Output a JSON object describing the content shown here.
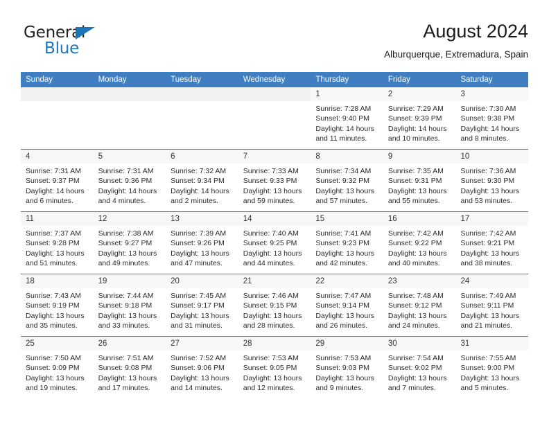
{
  "brand": {
    "name_part1": "General",
    "name_part2": "Blue",
    "triangle_color": "#1b75bb"
  },
  "header": {
    "title": "August 2024",
    "subtitle": "Alburquerque, Extremadura, Spain"
  },
  "calendar": {
    "header_color": "#3f7fc1",
    "weekdays": [
      "Sunday",
      "Monday",
      "Tuesday",
      "Wednesday",
      "Thursday",
      "Friday",
      "Saturday"
    ],
    "weeks": [
      [
        {
          "day": "",
          "sunrise": "",
          "sunset": "",
          "daylight_line1": "",
          "daylight_line2": ""
        },
        {
          "day": "",
          "sunrise": "",
          "sunset": "",
          "daylight_line1": "",
          "daylight_line2": ""
        },
        {
          "day": "",
          "sunrise": "",
          "sunset": "",
          "daylight_line1": "",
          "daylight_line2": ""
        },
        {
          "day": "",
          "sunrise": "",
          "sunset": "",
          "daylight_line1": "",
          "daylight_line2": ""
        },
        {
          "day": "1",
          "sunrise": "Sunrise: 7:28 AM",
          "sunset": "Sunset: 9:40 PM",
          "daylight_line1": "Daylight: 14 hours",
          "daylight_line2": "and 11 minutes."
        },
        {
          "day": "2",
          "sunrise": "Sunrise: 7:29 AM",
          "sunset": "Sunset: 9:39 PM",
          "daylight_line1": "Daylight: 14 hours",
          "daylight_line2": "and 10 minutes."
        },
        {
          "day": "3",
          "sunrise": "Sunrise: 7:30 AM",
          "sunset": "Sunset: 9:38 PM",
          "daylight_line1": "Daylight: 14 hours",
          "daylight_line2": "and 8 minutes."
        }
      ],
      [
        {
          "day": "4",
          "sunrise": "Sunrise: 7:31 AM",
          "sunset": "Sunset: 9:37 PM",
          "daylight_line1": "Daylight: 14 hours",
          "daylight_line2": "and 6 minutes."
        },
        {
          "day": "5",
          "sunrise": "Sunrise: 7:31 AM",
          "sunset": "Sunset: 9:36 PM",
          "daylight_line1": "Daylight: 14 hours",
          "daylight_line2": "and 4 minutes."
        },
        {
          "day": "6",
          "sunrise": "Sunrise: 7:32 AM",
          "sunset": "Sunset: 9:34 PM",
          "daylight_line1": "Daylight: 14 hours",
          "daylight_line2": "and 2 minutes."
        },
        {
          "day": "7",
          "sunrise": "Sunrise: 7:33 AM",
          "sunset": "Sunset: 9:33 PM",
          "daylight_line1": "Daylight: 13 hours",
          "daylight_line2": "and 59 minutes."
        },
        {
          "day": "8",
          "sunrise": "Sunrise: 7:34 AM",
          "sunset": "Sunset: 9:32 PM",
          "daylight_line1": "Daylight: 13 hours",
          "daylight_line2": "and 57 minutes."
        },
        {
          "day": "9",
          "sunrise": "Sunrise: 7:35 AM",
          "sunset": "Sunset: 9:31 PM",
          "daylight_line1": "Daylight: 13 hours",
          "daylight_line2": "and 55 minutes."
        },
        {
          "day": "10",
          "sunrise": "Sunrise: 7:36 AM",
          "sunset": "Sunset: 9:30 PM",
          "daylight_line1": "Daylight: 13 hours",
          "daylight_line2": "and 53 minutes."
        }
      ],
      [
        {
          "day": "11",
          "sunrise": "Sunrise: 7:37 AM",
          "sunset": "Sunset: 9:28 PM",
          "daylight_line1": "Daylight: 13 hours",
          "daylight_line2": "and 51 minutes."
        },
        {
          "day": "12",
          "sunrise": "Sunrise: 7:38 AM",
          "sunset": "Sunset: 9:27 PM",
          "daylight_line1": "Daylight: 13 hours",
          "daylight_line2": "and 49 minutes."
        },
        {
          "day": "13",
          "sunrise": "Sunrise: 7:39 AM",
          "sunset": "Sunset: 9:26 PM",
          "daylight_line1": "Daylight: 13 hours",
          "daylight_line2": "and 47 minutes."
        },
        {
          "day": "14",
          "sunrise": "Sunrise: 7:40 AM",
          "sunset": "Sunset: 9:25 PM",
          "daylight_line1": "Daylight: 13 hours",
          "daylight_line2": "and 44 minutes."
        },
        {
          "day": "15",
          "sunrise": "Sunrise: 7:41 AM",
          "sunset": "Sunset: 9:23 PM",
          "daylight_line1": "Daylight: 13 hours",
          "daylight_line2": "and 42 minutes."
        },
        {
          "day": "16",
          "sunrise": "Sunrise: 7:42 AM",
          "sunset": "Sunset: 9:22 PM",
          "daylight_line1": "Daylight: 13 hours",
          "daylight_line2": "and 40 minutes."
        },
        {
          "day": "17",
          "sunrise": "Sunrise: 7:42 AM",
          "sunset": "Sunset: 9:21 PM",
          "daylight_line1": "Daylight: 13 hours",
          "daylight_line2": "and 38 minutes."
        }
      ],
      [
        {
          "day": "18",
          "sunrise": "Sunrise: 7:43 AM",
          "sunset": "Sunset: 9:19 PM",
          "daylight_line1": "Daylight: 13 hours",
          "daylight_line2": "and 35 minutes."
        },
        {
          "day": "19",
          "sunrise": "Sunrise: 7:44 AM",
          "sunset": "Sunset: 9:18 PM",
          "daylight_line1": "Daylight: 13 hours",
          "daylight_line2": "and 33 minutes."
        },
        {
          "day": "20",
          "sunrise": "Sunrise: 7:45 AM",
          "sunset": "Sunset: 9:17 PM",
          "daylight_line1": "Daylight: 13 hours",
          "daylight_line2": "and 31 minutes."
        },
        {
          "day": "21",
          "sunrise": "Sunrise: 7:46 AM",
          "sunset": "Sunset: 9:15 PM",
          "daylight_line1": "Daylight: 13 hours",
          "daylight_line2": "and 28 minutes."
        },
        {
          "day": "22",
          "sunrise": "Sunrise: 7:47 AM",
          "sunset": "Sunset: 9:14 PM",
          "daylight_line1": "Daylight: 13 hours",
          "daylight_line2": "and 26 minutes."
        },
        {
          "day": "23",
          "sunrise": "Sunrise: 7:48 AM",
          "sunset": "Sunset: 9:12 PM",
          "daylight_line1": "Daylight: 13 hours",
          "daylight_line2": "and 24 minutes."
        },
        {
          "day": "24",
          "sunrise": "Sunrise: 7:49 AM",
          "sunset": "Sunset: 9:11 PM",
          "daylight_line1": "Daylight: 13 hours",
          "daylight_line2": "and 21 minutes."
        }
      ],
      [
        {
          "day": "25",
          "sunrise": "Sunrise: 7:50 AM",
          "sunset": "Sunset: 9:09 PM",
          "daylight_line1": "Daylight: 13 hours",
          "daylight_line2": "and 19 minutes."
        },
        {
          "day": "26",
          "sunrise": "Sunrise: 7:51 AM",
          "sunset": "Sunset: 9:08 PM",
          "daylight_line1": "Daylight: 13 hours",
          "daylight_line2": "and 17 minutes."
        },
        {
          "day": "27",
          "sunrise": "Sunrise: 7:52 AM",
          "sunset": "Sunset: 9:06 PM",
          "daylight_line1": "Daylight: 13 hours",
          "daylight_line2": "and 14 minutes."
        },
        {
          "day": "28",
          "sunrise": "Sunrise: 7:53 AM",
          "sunset": "Sunset: 9:05 PM",
          "daylight_line1": "Daylight: 13 hours",
          "daylight_line2": "and 12 minutes."
        },
        {
          "day": "29",
          "sunrise": "Sunrise: 7:53 AM",
          "sunset": "Sunset: 9:03 PM",
          "daylight_line1": "Daylight: 13 hours",
          "daylight_line2": "and 9 minutes."
        },
        {
          "day": "30",
          "sunrise": "Sunrise: 7:54 AM",
          "sunset": "Sunset: 9:02 PM",
          "daylight_line1": "Daylight: 13 hours",
          "daylight_line2": "and 7 minutes."
        },
        {
          "day": "31",
          "sunrise": "Sunrise: 7:55 AM",
          "sunset": "Sunset: 9:00 PM",
          "daylight_line1": "Daylight: 13 hours",
          "daylight_line2": "and 5 minutes."
        }
      ]
    ]
  }
}
